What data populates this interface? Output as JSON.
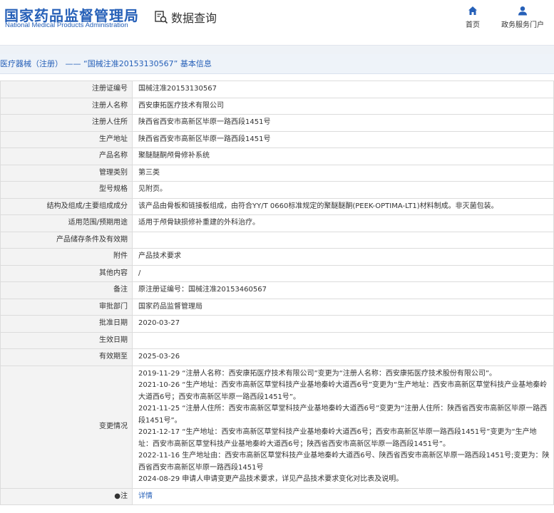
{
  "header": {
    "logo_cn": "国家药品监督管理局",
    "logo_en": "National Medical Products Administration",
    "data_query": "数据查询",
    "nav": [
      {
        "label": "首页",
        "icon": "home-icon"
      },
      {
        "label": "政务服务门户",
        "icon": "user-icon"
      }
    ]
  },
  "breadcrumb": "医疗器械（注册） —— “国械注准20153130567” 基本信息",
  "rows": [
    {
      "label": "注册证编号",
      "value": "国械注准20153130567"
    },
    {
      "label": "注册人名称",
      "value": "西安康拓医疗技术有限公司"
    },
    {
      "label": "注册人住所",
      "value": "陕西省西安市高新区毕原一路西段1451号"
    },
    {
      "label": "生产地址",
      "value": "陕西省西安市高新区毕原一路西段1451号"
    },
    {
      "label": "产品名称",
      "value": "聚醚醚酮颅骨修补系统"
    },
    {
      "label": "管理类别",
      "value": "第三类"
    },
    {
      "label": "型号规格",
      "value": "见附页。"
    },
    {
      "label": "结构及组成/主要组成成分",
      "value": "该产品由骨板和链接板组成，由符合YY/T 0660标准规定的聚醚醚酮(PEEK-OPTIMA-LT1)材料制成。非灭菌包装。"
    },
    {
      "label": "适用范围/预期用途",
      "value": "适用于颅骨缺损修补重建的外科治疗。"
    },
    {
      "label": "产品储存条件及有效期",
      "value": ""
    },
    {
      "label": "附件",
      "value": "产品技术要求"
    },
    {
      "label": "其他内容",
      "value": "/"
    },
    {
      "label": "备注",
      "value": "原注册证编号：国械注准20153460567"
    },
    {
      "label": "审批部门",
      "value": "国家药品监督管理局"
    },
    {
      "label": "批准日期",
      "value": "2020-03-27"
    },
    {
      "label": "生效日期",
      "value": ""
    },
    {
      "label": "有效期至",
      "value": "2025-03-26"
    }
  ],
  "change": {
    "label": "变更情况",
    "lines": [
      "2019-11-29 “注册人名称：西安康拓医疗技术有限公司”变更为“注册人名称：西安康拓医疗技术股份有限公司”。",
      "2021-10-26 “生产地址：西安市高新区草堂科技产业基地秦岭大道西6号”变更为“生产地址：西安市高新区草堂科技产业基地秦岭大道西6号；西安市高新区毕原一路西段1451号”。",
      "2021-11-25 “注册人住所：西安市高新区草堂科技产业基地秦岭大道西6号”变更为“注册人住所：陕西省西安市高新区毕原一路西段1451号”。",
      "2021-12-17 “生产地址：西安市高新区草堂科技产业基地秦岭大道西6号；西安市高新区毕原一路西段1451号”变更为“生产地址：西安市高新区草堂科技产业基地秦岭大道西6号；陕西省西安市高新区毕原一路西段1451号”。",
      "2022-11-16 生产地址由：西安市高新区草堂科技产业基地秦岭大道西6号、陕西省西安市高新区毕原一路西段1451号;变更为：陕西省西安市高新区毕原一路西段1451号",
      "2024-08-29 申请人申请变更产品技术要求，详见产品技术要求变化对比表及说明。"
    ]
  },
  "note": {
    "label": "●注",
    "value": "详情"
  },
  "colors": {
    "brand": "#2660b8",
    "label_bg": "#f3f3f3",
    "border": "#dcdcdc"
  }
}
